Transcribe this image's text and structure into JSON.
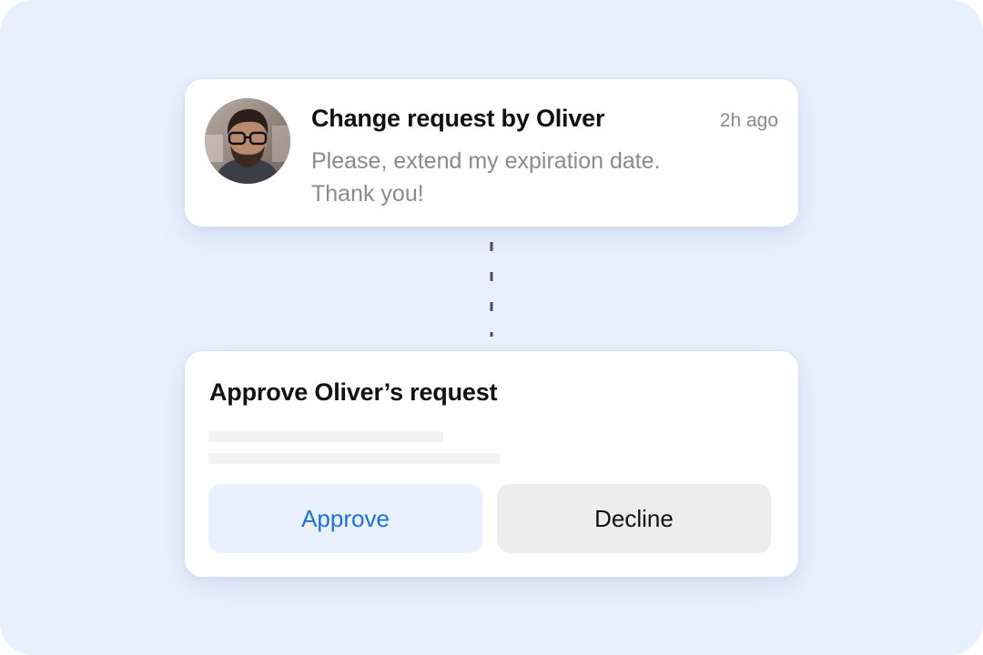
{
  "request": {
    "title": "Change request by Oliver",
    "time": "2h ago",
    "message_line1": "Please, extend my expiration date.",
    "message_line2": "Thank you!"
  },
  "approval": {
    "title": "Approve Oliver’s request",
    "approve_label": "Approve",
    "decline_label": "Decline"
  },
  "colors": {
    "background": "#e9f0fd",
    "card": "#ffffff",
    "approve_text": "#1f6fe0",
    "approve_bg": "#eaf1fe",
    "decline_bg": "#ededed",
    "connector": "#4a4a6a"
  }
}
